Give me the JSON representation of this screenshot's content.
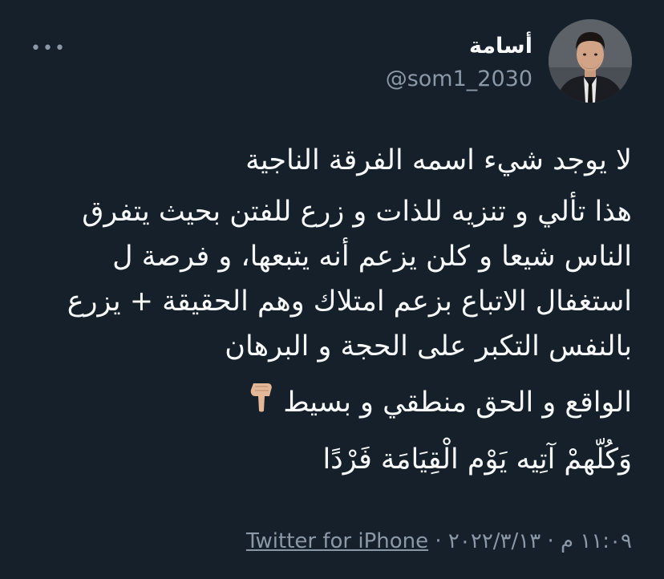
{
  "tweet": {
    "author": {
      "display_name": "أسامة",
      "handle": "@som1_2030",
      "avatar_icon": "profile-photo"
    },
    "more_icon": "ellipsis-icon",
    "more_label": "•••",
    "paragraphs": [
      "لا يوجد شيء اسمه الفرقة الناجية",
      "هذا تألي و تنزيه للذات و زرع للفتن بحيث يتفرق الناس شيعا و كلن يزعم أنه يتبعها، و فرصة ل استغفال الاتباع بزعم امتلاك وهم الحقيقة + يزرع بالنفس التكبر على الحجة و البرهان",
      "الواقع و الحق منطقي و بسيط",
      "وَكُلّهمْ آتِيه يَوْم الْقِيَامَة فَرْدًا"
    ],
    "emoji_icon": "pointing-down-hand-icon",
    "meta": {
      "date": "٢٠٢٢/٣/١٣",
      "separator": "·",
      "time": "١١:٠٩ م",
      "source": "Twitter for iPhone"
    }
  },
  "colors": {
    "background": "#15202b",
    "text": "#f7f9f9",
    "secondary": "#8b98a5"
  }
}
